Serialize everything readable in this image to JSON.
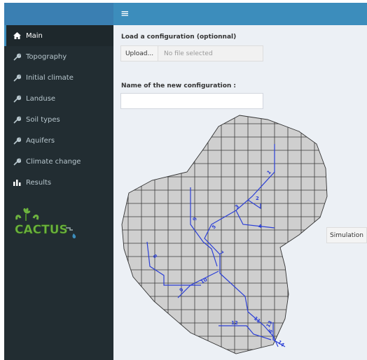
{
  "topbar": {
    "menu_icon": "hamburger-icon"
  },
  "sidebar": {
    "items": [
      {
        "label": "Main",
        "icon": "home-icon",
        "active": true
      },
      {
        "label": "Topography",
        "icon": "wrench-icon"
      },
      {
        "label": "Initial climate",
        "icon": "wrench-icon"
      },
      {
        "label": "Landuse",
        "icon": "wrench-icon"
      },
      {
        "label": "Soil types",
        "icon": "wrench-icon"
      },
      {
        "label": "Aquifers",
        "icon": "wrench-icon"
      },
      {
        "label": "Climate change",
        "icon": "wrench-icon"
      },
      {
        "label": "Results",
        "icon": "bar-chart-icon"
      }
    ],
    "logo_text": "CACTUS"
  },
  "main": {
    "load_label": "Load a configuration (optionnal)",
    "upload_label": "Upload...",
    "file_status": "No file selected",
    "name_label": "Name of the new configuration :",
    "name_value": "",
    "simulation_label": "Simulation",
    "river_labels": [
      "1",
      "2",
      "3",
      "4",
      "5",
      "6",
      "7",
      "8",
      "9",
      "10",
      "11",
      "12",
      "13",
      "14"
    ]
  },
  "colors": {
    "header": "#3c8dbc",
    "sidebar": "#222d32",
    "content": "#ecf0f5",
    "river": "#2b3fd6",
    "catchment": "#cfcfcf"
  }
}
